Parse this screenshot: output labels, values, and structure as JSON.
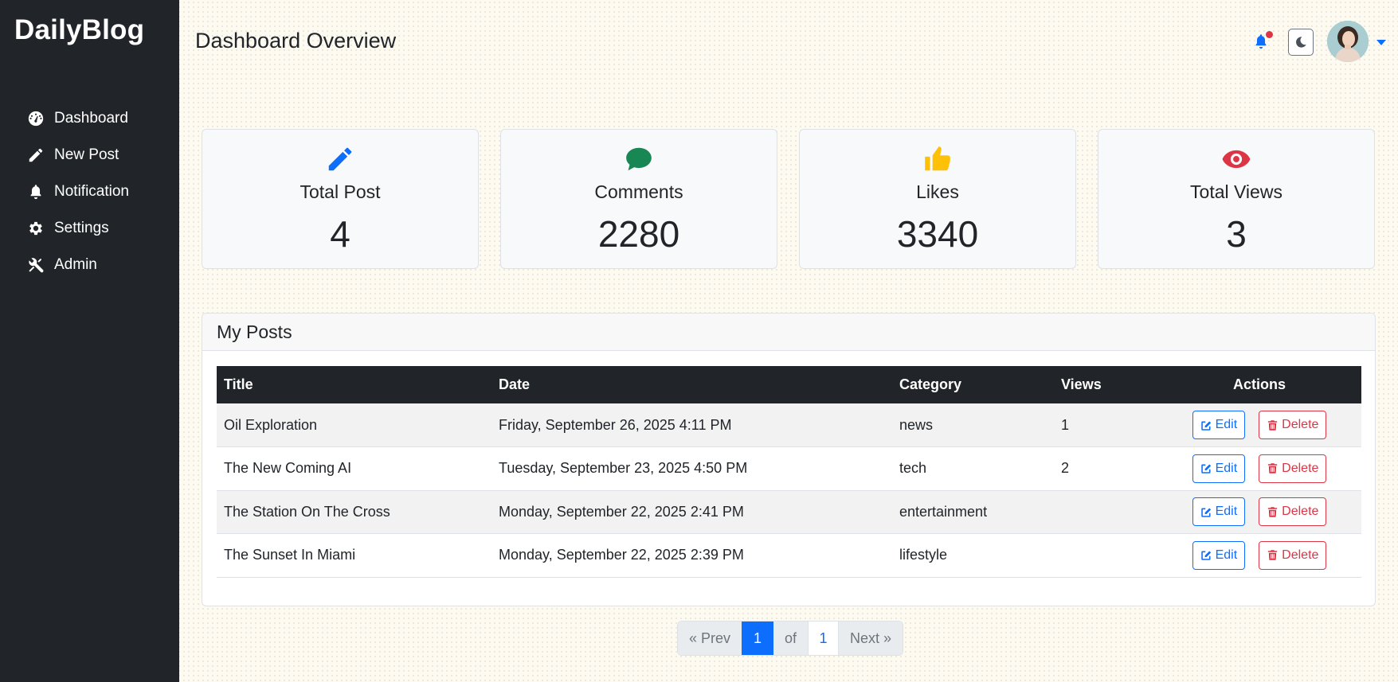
{
  "sidebar": {
    "brand": "DailyBlog",
    "items": [
      {
        "label": "Dashboard",
        "icon": "dashboard-gauge-icon"
      },
      {
        "label": "New Post",
        "icon": "pencil-icon"
      },
      {
        "label": "Notification",
        "icon": "bell-icon"
      },
      {
        "label": "Settings",
        "icon": "gear-icon"
      },
      {
        "label": "Admin",
        "icon": "tools-icon"
      }
    ]
  },
  "header": {
    "title": "Dashboard Overview",
    "notification_indicator": true,
    "theme_toggle_icon": "moon-icon"
  },
  "stats": [
    {
      "label": "Total Post",
      "value": "4",
      "icon": "pencil-icon",
      "color": "#0d6efd"
    },
    {
      "label": "Comments",
      "value": "2280",
      "icon": "chat-bubble-icon",
      "color": "#198754"
    },
    {
      "label": "Likes",
      "value": "3340",
      "icon": "thumbs-up-icon",
      "color": "#ffc107"
    },
    {
      "label": "Total Views",
      "value": "3",
      "icon": "eye-icon",
      "color": "#dc3545"
    }
  ],
  "posts": {
    "heading": "My Posts",
    "columns": [
      "Title",
      "Date",
      "Category",
      "Views",
      "Actions"
    ],
    "rows": [
      {
        "title": "Oil Exploration",
        "date": "Friday, September 26, 2025 4:11 PM",
        "category": "news",
        "views": "1"
      },
      {
        "title": "The New Coming AI",
        "date": "Tuesday, September 23, 2025 4:50 PM",
        "category": "tech",
        "views": "2"
      },
      {
        "title": "The Station On The Cross",
        "date": "Monday, September 22, 2025 2:41 PM",
        "category": "entertainment",
        "views": ""
      },
      {
        "title": "The Sunset In Miami",
        "date": "Monday, September 22, 2025 2:39 PM",
        "category": "lifestyle",
        "views": ""
      }
    ],
    "edit_label": "Edit",
    "delete_label": "Delete"
  },
  "pagination": {
    "prev_label": "« Prev",
    "current": "1",
    "of_label": "of",
    "total": "1",
    "next_label": "Next »"
  },
  "colors": {
    "accent": "#0d6efd",
    "danger": "#dc3545",
    "sidebar_bg": "#212529"
  }
}
